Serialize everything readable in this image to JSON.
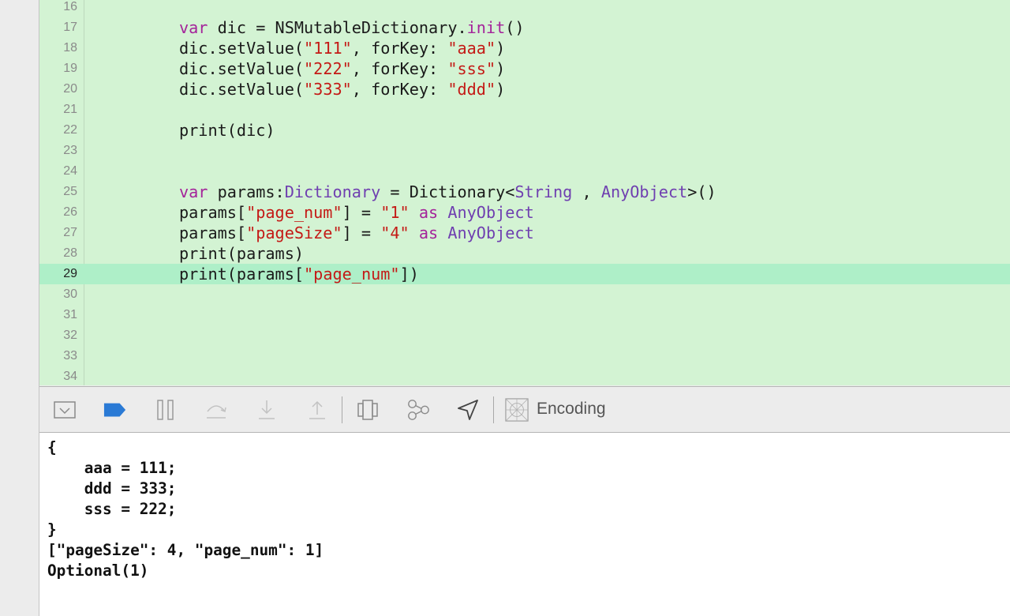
{
  "editor": {
    "current_line": "29",
    "lines": [
      {
        "num": "16",
        "tokens": []
      },
      {
        "num": "17",
        "tokens": [
          {
            "t": "var",
            "c": "kw"
          },
          {
            "t": " dic = NSMutableDictionary.",
            "c": ""
          },
          {
            "t": "init",
            "c": "kw"
          },
          {
            "t": "()",
            "c": ""
          }
        ]
      },
      {
        "num": "18",
        "tokens": [
          {
            "t": "dic.setValue(",
            "c": ""
          },
          {
            "t": "\"111\"",
            "c": "str"
          },
          {
            "t": ", forKey: ",
            "c": ""
          },
          {
            "t": "\"aaa\"",
            "c": "str"
          },
          {
            "t": ")",
            "c": ""
          }
        ]
      },
      {
        "num": "19",
        "tokens": [
          {
            "t": "dic.setValue(",
            "c": ""
          },
          {
            "t": "\"222\"",
            "c": "str"
          },
          {
            "t": ", forKey: ",
            "c": ""
          },
          {
            "t": "\"sss\"",
            "c": "str"
          },
          {
            "t": ")",
            "c": ""
          }
        ]
      },
      {
        "num": "20",
        "tokens": [
          {
            "t": "dic.setValue(",
            "c": ""
          },
          {
            "t": "\"333\"",
            "c": "str"
          },
          {
            "t": ", forKey: ",
            "c": ""
          },
          {
            "t": "\"ddd\"",
            "c": "str"
          },
          {
            "t": ")",
            "c": ""
          }
        ]
      },
      {
        "num": "21",
        "tokens": []
      },
      {
        "num": "22",
        "tokens": [
          {
            "t": "print(dic)",
            "c": ""
          }
        ]
      },
      {
        "num": "23",
        "tokens": []
      },
      {
        "num": "24",
        "tokens": []
      },
      {
        "num": "25",
        "tokens": [
          {
            "t": "var",
            "c": "kw"
          },
          {
            "t": " params:",
            "c": ""
          },
          {
            "t": "Dictionary",
            "c": "type"
          },
          {
            "t": " = Dictionary<",
            "c": ""
          },
          {
            "t": "String",
            "c": "type"
          },
          {
            "t": " , ",
            "c": ""
          },
          {
            "t": "AnyObject",
            "c": "type"
          },
          {
            "t": ">()",
            "c": ""
          }
        ]
      },
      {
        "num": "26",
        "tokens": [
          {
            "t": "params[",
            "c": ""
          },
          {
            "t": "\"page_num\"",
            "c": "str"
          },
          {
            "t": "] = ",
            "c": ""
          },
          {
            "t": "\"1\"",
            "c": "str"
          },
          {
            "t": " ",
            "c": ""
          },
          {
            "t": "as",
            "c": "kw"
          },
          {
            "t": " ",
            "c": ""
          },
          {
            "t": "AnyObject",
            "c": "type"
          }
        ]
      },
      {
        "num": "27",
        "tokens": [
          {
            "t": "params[",
            "c": ""
          },
          {
            "t": "\"pageSize\"",
            "c": "str"
          },
          {
            "t": "] = ",
            "c": ""
          },
          {
            "t": "\"4\"",
            "c": "str"
          },
          {
            "t": " ",
            "c": ""
          },
          {
            "t": "as",
            "c": "kw"
          },
          {
            "t": " ",
            "c": ""
          },
          {
            "t": "AnyObject",
            "c": "type"
          }
        ]
      },
      {
        "num": "28",
        "tokens": [
          {
            "t": "print(params)",
            "c": ""
          }
        ]
      },
      {
        "num": "29",
        "tokens": [
          {
            "t": "print(params[",
            "c": ""
          },
          {
            "t": "\"page_num\"",
            "c": "str"
          },
          {
            "t": "])",
            "c": ""
          }
        ]
      },
      {
        "num": "30",
        "tokens": []
      },
      {
        "num": "31",
        "tokens": []
      },
      {
        "num": "32",
        "tokens": []
      },
      {
        "num": "33",
        "tokens": []
      },
      {
        "num": "34",
        "tokens": []
      }
    ]
  },
  "debug_bar": {
    "buttons": [
      {
        "name": "hide-debug-area-icon"
      },
      {
        "name": "breakpoints-toggle-icon"
      },
      {
        "name": "pause-icon"
      },
      {
        "name": "step-over-icon"
      },
      {
        "name": "step-into-icon"
      },
      {
        "name": "step-out-icon"
      },
      {
        "name": "view-debugger-icon"
      },
      {
        "name": "memory-graph-icon"
      },
      {
        "name": "simulate-location-icon"
      },
      {
        "name": "environment-overrides-icon"
      }
    ],
    "encoding_label": "Encoding"
  },
  "console": {
    "lines": [
      "{",
      "    aaa = 111;",
      "    ddd = 333;",
      "    sss = 222;",
      "}",
      "[\"pageSize\": 4, \"page_num\": 1]",
      "Optional(1)"
    ]
  },
  "colors": {
    "editor_bg": "#d3f3d3",
    "current_line_bg": "#aeefc8",
    "keyword": "#a4239a",
    "string": "#c41a16",
    "type": "#6f3fb0",
    "accent_blue": "#2a7ad5"
  }
}
